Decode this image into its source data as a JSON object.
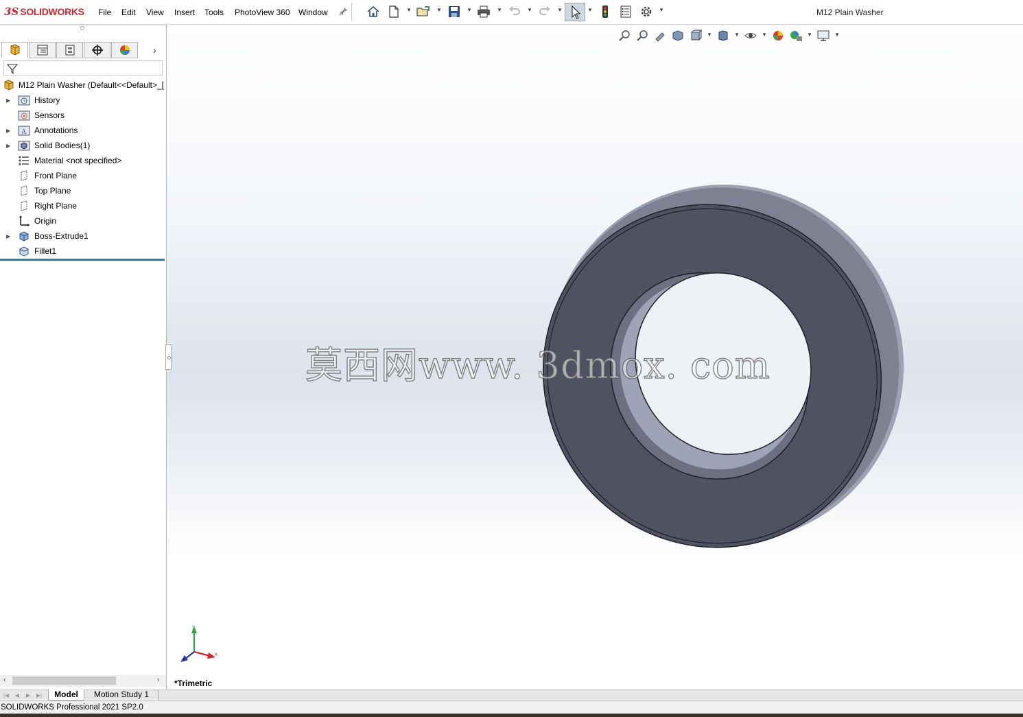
{
  "app": {
    "brand_prefix": "3S",
    "brand": "SOLIDWORKS",
    "document_title": "M12 Plain Washer",
    "version_status": "SOLIDWORKS Professional 2021 SP2.0"
  },
  "menu": [
    "File",
    "Edit",
    "View",
    "Insert",
    "Tools",
    "PhotoView 360",
    "Window"
  ],
  "toolbar": {
    "icons": [
      "pin-icon",
      "home-icon",
      "new-document-icon",
      "open-icon",
      "save-icon",
      "print-icon",
      "undo-icon",
      "redo-icon",
      "select-icon",
      "rebuild-icon",
      "file-properties-icon",
      "options-icon"
    ]
  },
  "feature_tree": {
    "tabs": [
      "feature-manager",
      "property-manager",
      "configuration-manager",
      "dimxpert-manager",
      "display-manager"
    ],
    "root": "M12 Plain Washer  (Default<<Default>_[",
    "items": [
      {
        "label": "History",
        "icon": "history-folder-icon",
        "expandable": true
      },
      {
        "label": "Sensors",
        "icon": "sensors-folder-icon",
        "expandable": false
      },
      {
        "label": "Annotations",
        "icon": "annotations-folder-icon",
        "expandable": true
      },
      {
        "label": "Solid Bodies(1)",
        "icon": "solid-bodies-folder-icon",
        "expandable": true
      },
      {
        "label": "Material <not specified>",
        "icon": "material-icon",
        "expandable": false
      },
      {
        "label": "Front Plane",
        "icon": "plane-icon",
        "expandable": false
      },
      {
        "label": "Top Plane",
        "icon": "plane-icon",
        "expandable": false
      },
      {
        "label": "Right Plane",
        "icon": "plane-icon",
        "expandable": false
      },
      {
        "label": "Origin",
        "icon": "origin-icon",
        "expandable": false
      },
      {
        "label": "Boss-Extrude1",
        "icon": "extrude-feature-icon",
        "expandable": true
      },
      {
        "label": "Fillet1",
        "icon": "fillet-feature-icon",
        "expandable": false
      }
    ]
  },
  "viewport": {
    "view_label": "*Trimetric",
    "watermark": "莫西网www. 3dmox. com",
    "triad": {
      "x": "x",
      "y": "y"
    },
    "part_color": "#4f5261",
    "hud_icons": [
      "zoom-to-fit-icon",
      "zoom-to-area-icon",
      "previous-view-icon",
      "section-view-icon",
      "view-orientation-icon",
      "display-style-icon",
      "hide-show-items-icon",
      "edit-appearance-icon",
      "apply-scene-icon",
      "view-settings-icon"
    ]
  },
  "bottom_tabs": [
    "Model",
    "Motion Study 1"
  ],
  "colors": {
    "brand_red": "#d8232a",
    "rollback_bar": "#1f7fb0",
    "select_active": "#cfd6dd"
  }
}
